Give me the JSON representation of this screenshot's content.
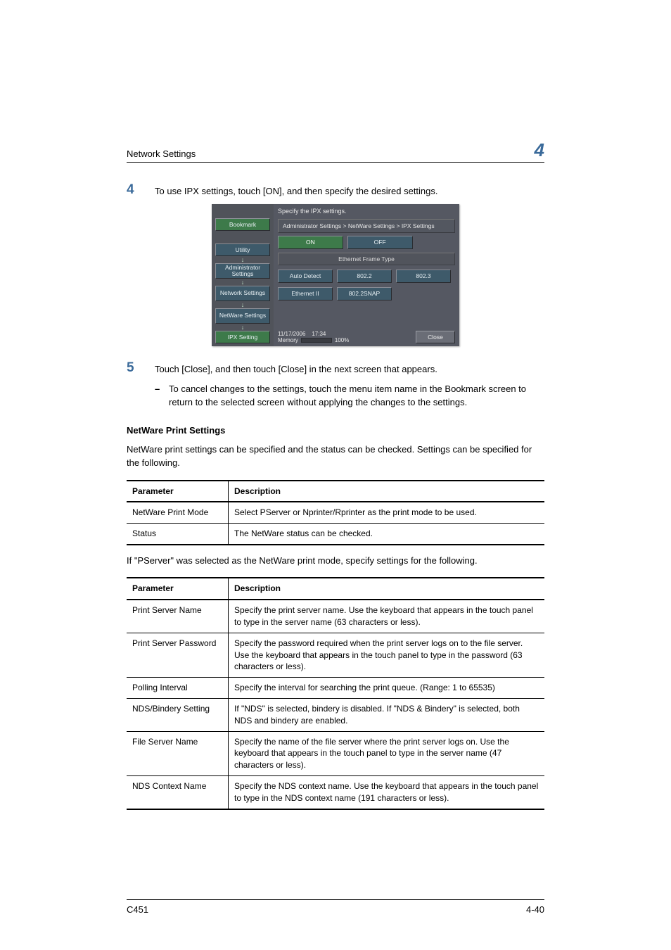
{
  "header": {
    "title": "Network Settings",
    "chapter": "4"
  },
  "step4": {
    "num": "4",
    "text": "To use IPX settings, touch [ON], and then specify the desired settings."
  },
  "panel": {
    "instruction": "Specify the IPX settings.",
    "breadcrumb": "Administrator Settings > NetWare Settings > IPX Settings",
    "left": {
      "bookmark": "Bookmark",
      "utility": "Utility",
      "admin": "Administrator Settings",
      "network": "Network Settings",
      "netware": "NetWare Settings",
      "ipx": "IPX Setting"
    },
    "on": "ON",
    "off": "OFF",
    "eft_label": "Ethernet Frame Type",
    "opts": {
      "auto": "Auto Detect",
      "e8022": "802.2",
      "e8023": "802.3",
      "eth2": "Ethernet II",
      "snap": "802.2SNAP"
    },
    "date": "11/17/2006",
    "time": "17:34",
    "memory": "Memory",
    "mem_pct": "100%",
    "close": "Close"
  },
  "step5": {
    "num": "5",
    "text": "Touch [Close], and then touch [Close] in the next screen that appears.",
    "sub": "To cancel changes to the settings, touch the menu item name in the Bookmark screen to return to the selected screen without applying the changes to the settings."
  },
  "section": {
    "heading": "NetWare Print Settings",
    "intro": "NetWare print settings can be specified and the status can be checked. Settings can be specified for the following."
  },
  "table1": {
    "hparam": "Parameter",
    "hdesc": "Description",
    "rows": [
      {
        "p": "NetWare Print Mode",
        "d": "Select PServer or Nprinter/Rprinter as the print mode to be used."
      },
      {
        "p": "Status",
        "d": "The NetWare status can be checked."
      }
    ]
  },
  "pserver_intro": "If \"PServer\" was selected as the NetWare print mode, specify settings for the following.",
  "table2": {
    "hparam": "Parameter",
    "hdesc": "Description",
    "rows": [
      {
        "p": "Print Server Name",
        "d": "Specify the print server name. Use the keyboard that appears in the touch panel to type in the server name (63 characters or less)."
      },
      {
        "p": "Print Server Password",
        "d": "Specify the password required when the print server logs on to the file server. Use the keyboard that appears in the touch panel to type in the password (63 characters or less)."
      },
      {
        "p": "Polling Interval",
        "d": "Specify the interval for searching the print queue. (Range: 1 to 65535)"
      },
      {
        "p": "NDS/Bindery Setting",
        "d": "If \"NDS\" is selected, bindery is disabled. If \"NDS & Bindery\" is selected, both NDS and bindery are enabled."
      },
      {
        "p": "File Server Name",
        "d": "Specify the name of the file server where the print server logs on. Use the keyboard that appears in the touch panel to type in the server name (47 characters or less)."
      },
      {
        "p": "NDS Context Name",
        "d": "Specify the NDS context name. Use the keyboard that appears in the touch panel to type in the NDS context name (191 characters or less)."
      }
    ]
  },
  "footer": {
    "left": "C451",
    "right": "4-40"
  }
}
